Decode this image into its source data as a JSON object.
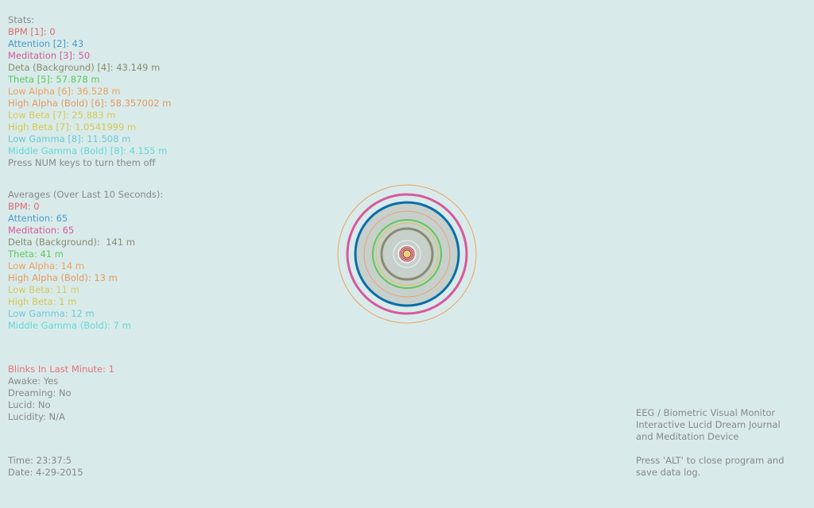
{
  "colors": {
    "background": "#d8ebea",
    "bpm": "#e06870",
    "attention": "#4a9ac8",
    "meditation": "#d8589a",
    "delta": "#8a8a70",
    "theta": "#5cc85c",
    "low_alpha": "#eea060",
    "high_alpha": "#e89860",
    "low_beta": "#d8c858",
    "high_beta": "#d6c84e",
    "low_gamma": "#6cc8d4",
    "middle_gamma": "#66d6d6",
    "neutral": "#888888",
    "blinks": "#e8707a"
  },
  "stats": {
    "title": "Stats:",
    "bpm": "BPM [1]: 0",
    "attention": "Attention [2]: 43",
    "meditation": "Meditation [3]: 50",
    "delta": "Deta (Background) [4]: 43.149 m",
    "theta": "Theta [5]: 57.878 m",
    "low_alpha": "Low Alpha [6]: 36.528 m",
    "high_alpha": "High Alpha (Bold) [6]: 58.357002 m",
    "low_beta": "Low Beta [7]: 25.883 m",
    "high_beta": "High Beta [7]: 1.0541999 m",
    "low_gamma": "Low Gamma [8]: 11.508 m",
    "middle_gamma": "Middle Gamma (Bold) [8]: 4.155 m",
    "hint": "Press NUM keys to turn them off"
  },
  "averages": {
    "title": "Averages (Over Last 10 Seconds):",
    "bpm": "BPM: 0",
    "attention": "Attention: 65",
    "meditation": "Meditation: 65",
    "delta": "Delta (Background):  141 m",
    "theta": "Theta: 41 m",
    "low_alpha": "Low Alpha: 14 m",
    "high_alpha": "High Alpha (Bold): 13 m",
    "low_beta": "Low Beta: 11 m",
    "high_beta": "High Beta: 1 m",
    "low_gamma": "Low Gamma: 12 m",
    "middle_gamma": "Middle Gamma (Bold): 7 m"
  },
  "state": {
    "blinks": "Blinks In Last Minute: 1",
    "awake": "Awake: Yes",
    "dreaming": "Dreaming: No",
    "lucid": "Lucid: No",
    "lucidity": "Lucidity: N/A"
  },
  "time": {
    "time": "Time: 23:37:5",
    "date": "Date: 4-29-2015"
  },
  "info": {
    "line1": "EEG / Biometric Visual Monitor",
    "line2": "Interactive Lucid Dream Journal",
    "line3": "and Meditation Device",
    "line4": "Press 'ALT' to close program and",
    "line5": "save data log."
  }
}
